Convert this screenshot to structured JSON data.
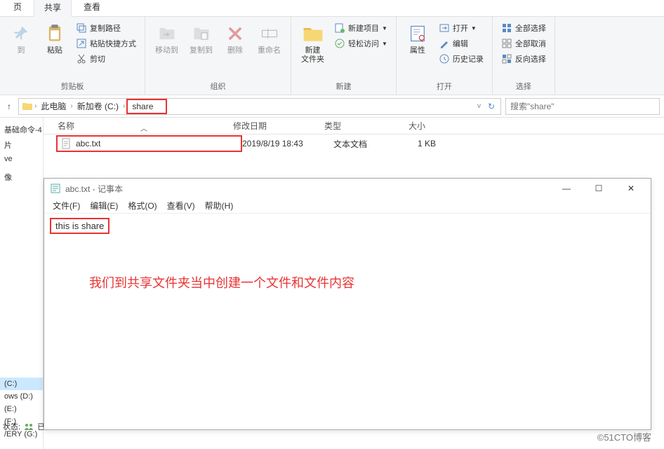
{
  "tabs": {
    "page": "页",
    "share": "共享",
    "view": "查看"
  },
  "ribbon": {
    "clipboard": {
      "label": "剪贴板",
      "paste": "粘贴",
      "copy_path": "复制路径",
      "paste_shortcut": "粘贴快捷方式",
      "cut": "剪切",
      "col1": "到"
    },
    "organize": {
      "label": "组织",
      "move_to": "移动到",
      "copy_to": "复制到",
      "delete": "删除",
      "rename": "重命名"
    },
    "new": {
      "label": "新建",
      "new_folder": "新建\n文件夹",
      "new_item": "新建项目",
      "easy_access": "轻松访问"
    },
    "open": {
      "label": "打开",
      "properties": "属性",
      "open": "打开",
      "edit": "编辑",
      "history": "历史记录"
    },
    "select": {
      "label": "选择",
      "select_all": "全部选择",
      "deselect": "全部取消",
      "invert": "反向选择"
    }
  },
  "breadcrumb": {
    "this_pc": "此电脑",
    "drive": "新加卷 (C:)",
    "folder": "share"
  },
  "search": {
    "placeholder": "搜索\"share\""
  },
  "sidebar": {
    "top_label": "基础命令-4",
    "items": [
      "片",
      "ve",
      "",
      "像"
    ],
    "drives": [
      "(C:)",
      "ows (D:)",
      "(E:)",
      "(F:)",
      "/ERY (G:)"
    ],
    "status": "状态:",
    "ready": "已共"
  },
  "file_list": {
    "headers": {
      "name": "名称",
      "date": "修改日期",
      "type": "类型",
      "size": "大小"
    },
    "row": {
      "name": "abc.txt",
      "date": "2019/8/19 18:43",
      "type": "文本文档",
      "size": "1 KB"
    }
  },
  "notepad": {
    "title": "abc.txt - 记事本",
    "menus": {
      "file": "文件(F)",
      "edit": "编辑(E)",
      "format": "格式(O)",
      "view": "查看(V)",
      "help": "帮助(H)"
    },
    "content": "this is share",
    "annotation": "我们到共享文件夹当中创建一个文件和文件内容"
  },
  "watermark": "©51CTO博客"
}
